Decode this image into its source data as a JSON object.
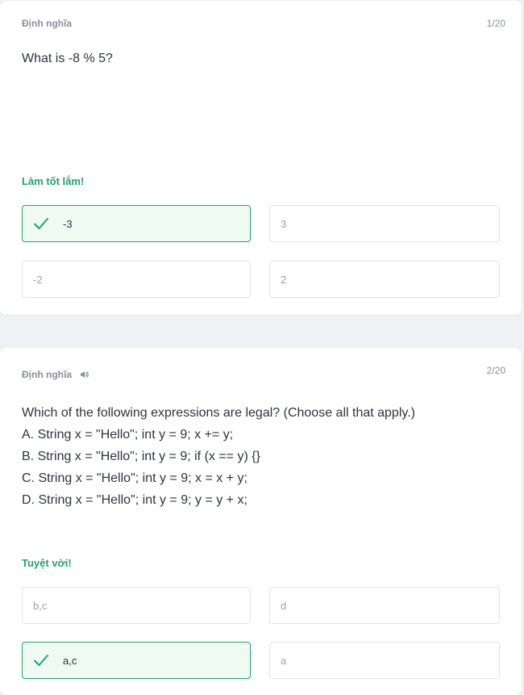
{
  "cards": [
    {
      "term_label": "Định nghĩa",
      "counter": "1/20",
      "question_lines": [
        "What is -8 % 5?"
      ],
      "feedback": "Làm tốt lắm!",
      "options": [
        {
          "label": "-3",
          "correct": true
        },
        {
          "label": "3",
          "correct": false
        },
        {
          "label": "-2",
          "correct": false
        },
        {
          "label": "2",
          "correct": false
        }
      ]
    },
    {
      "term_label": "Định nghĩa",
      "has_audio": true,
      "counter": "2/20",
      "question_lines": [
        "Which of the following expressions are legal? (Choose all that apply.)",
        "A. String x = \"Hello\"; int y = 9; x += y;",
        "B. String x = \"Hello\"; int y = 9; if (x == y) {}",
        "C. String x = \"Hello\"; int y = 9; x = x + y;",
        "D. String x = \"Hello\"; int y = 9; y = y + x;"
      ],
      "feedback": "Tuyệt vời!",
      "options": [
        {
          "label": "b,c",
          "correct": false
        },
        {
          "label": "d",
          "correct": false
        },
        {
          "label": "a,c",
          "correct": true
        },
        {
          "label": "a",
          "correct": false
        }
      ]
    }
  ],
  "colors": {
    "accent_green": "#23a26d",
    "correct_bg": "#effaf3",
    "muted_text": "#8a8f9c",
    "question_text": "#2e3342"
  },
  "icons": {
    "check": "check-icon",
    "audio": "speaker-icon"
  }
}
